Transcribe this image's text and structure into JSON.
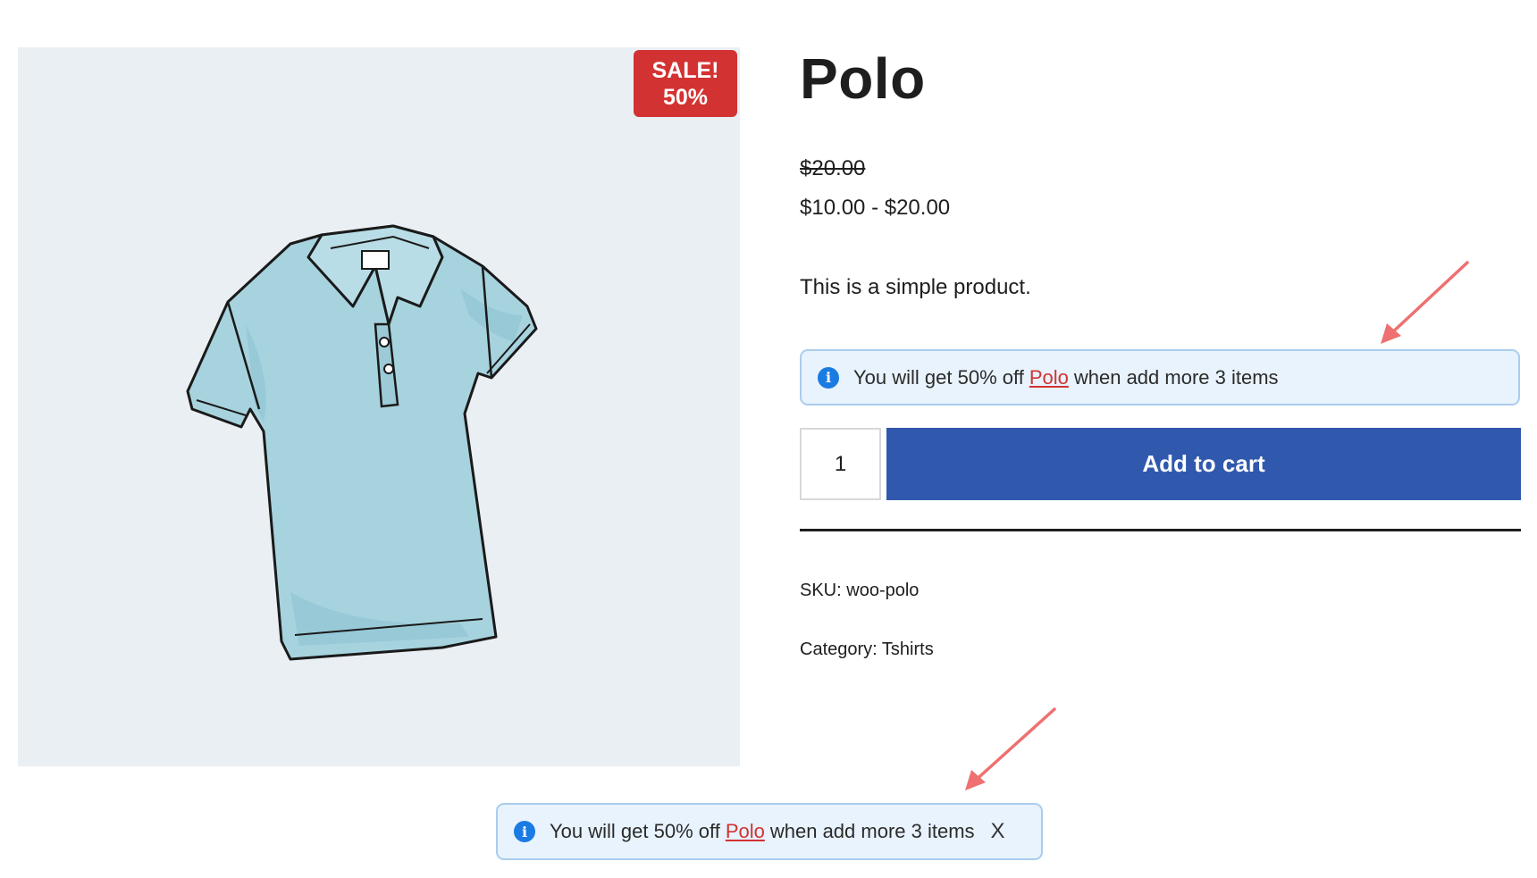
{
  "product": {
    "title": "Polo",
    "old_price": "$20.00",
    "price_range": "$10.00 - $20.00",
    "description": "This is a simple product.",
    "image_icon": "polo-shirt-illustration"
  },
  "badge": {
    "line1": "SALE!",
    "line2": "50%",
    "color": "#d33232"
  },
  "notice_inline": {
    "text_before": "You will get 50% off",
    "link": "Polo",
    "text_after": "when add more 3 items",
    "icon": "info-icon"
  },
  "notice_toast": {
    "text_before": "You will get 50% off",
    "link": "Polo",
    "text_after": "when add more 3 items",
    "icon": "info-icon",
    "close_label": "X"
  },
  "cart": {
    "quantity": "1",
    "add_label": "Add to cart",
    "button_color": "#3058ad"
  },
  "meta": {
    "sku_label": "SKU:",
    "sku_value": "woo-polo",
    "category_label": "Category:",
    "category_value": "Tshirts"
  },
  "annotations": {
    "arrow_color": "#ee7070"
  }
}
